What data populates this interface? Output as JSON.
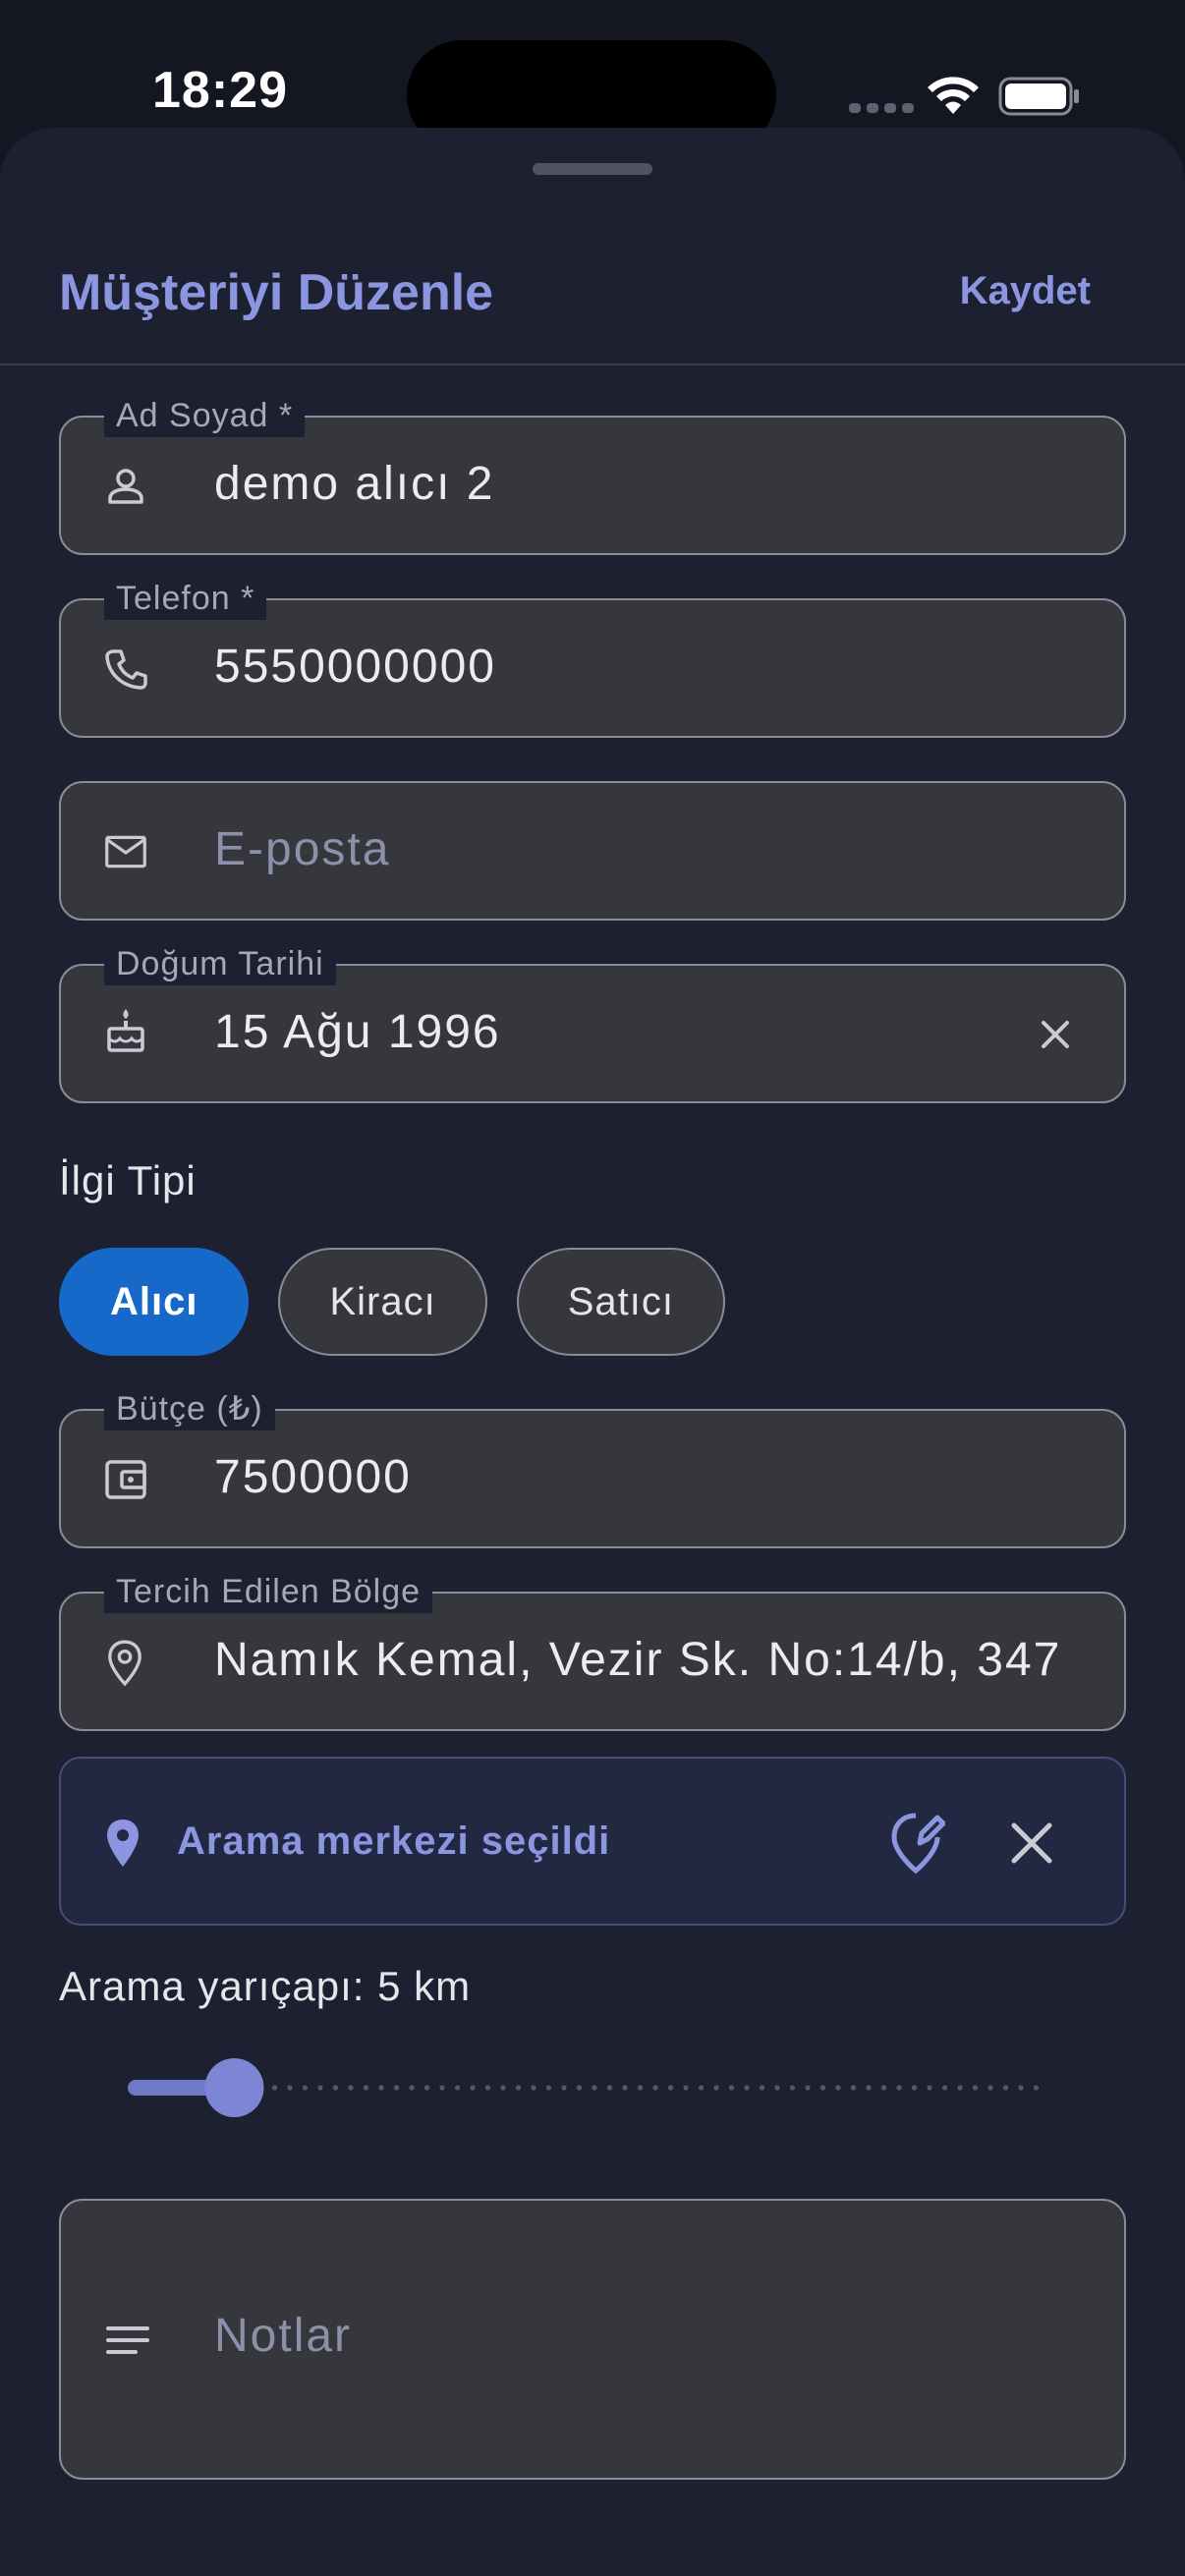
{
  "status_bar": {
    "time": "18:29"
  },
  "header": {
    "title": "Müşteriyi Düzenle",
    "save_label": "Kaydet"
  },
  "form": {
    "name": {
      "label": "Ad Soyad *",
      "value": "demo alıcı 2"
    },
    "phone": {
      "label": "Telefon *",
      "value": "5550000000"
    },
    "email": {
      "placeholder": "E-posta"
    },
    "birthday": {
      "label": "Doğum Tarihi",
      "value": "15 Ağu 1996"
    },
    "interest": {
      "label": "İlgi Tipi",
      "options": [
        "Alıcı",
        "Kiracı",
        "Satıcı"
      ],
      "selected": "Alıcı"
    },
    "budget": {
      "label": "Bütçe (₺)",
      "value": "7500000"
    },
    "region": {
      "label": "Tercih Edilen Bölge",
      "value": "Namık Kemal, Vezir Sk. No:14/b, 347"
    },
    "search_center": {
      "text": "Arama merkezi seçildi"
    },
    "radius": {
      "label": "Arama yarıçapı: 5 km",
      "value_km": 5,
      "fraction": 0.085
    },
    "notes": {
      "placeholder": "Notlar"
    }
  },
  "colors": {
    "accent": "#8c96e0",
    "chip_selected": "#1769c9",
    "sheet_bg": "#1d2030",
    "field_bg": "#36363d"
  }
}
